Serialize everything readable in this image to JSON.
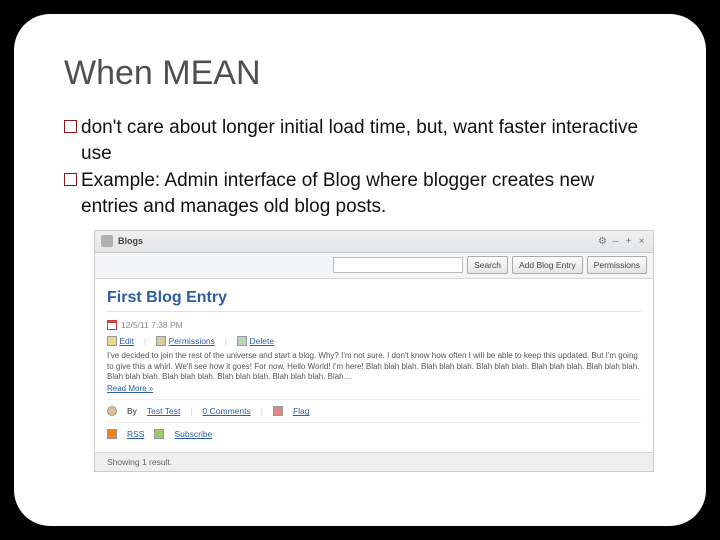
{
  "slide": {
    "title": "When MEAN",
    "bullets": [
      "don't care about longer initial load time, but, want faster interactive use",
      "Example: Admin interface of Blog where blogger creates new entries and manages old blog posts."
    ]
  },
  "shot": {
    "window_title": "Blogs",
    "toolbar": {
      "search_btn": "Search",
      "add_btn": "Add Blog Entry",
      "perm_btn": "Permissions"
    },
    "entry": {
      "title": "First Blog Entry",
      "timestamp": "12/5/11 7:38 PM",
      "actions": {
        "edit": "Edit",
        "permissions": "Permissions",
        "delete": "Delete"
      },
      "body": "I've decided to join the rest of the universe and start a blog. Why? I'm not sure. I don't know how often I will be able to keep this updated. But I'm going to give this a whirl. We'll see how it goes! For now, Hello World! I'm here!  Blah blah blah. Blah blah blah. Blah blah blah. Blah blah blah. Blah blah blah. Blah blah blah. Blah blah blah. Blah blah blah. Blah blah blah. Blah…",
      "readmore": "Read More »",
      "author_prefix": "By",
      "author": "Test Test",
      "comments": "0 Comments",
      "flag": "Flag",
      "rss": "RSS",
      "subscribe": "Subscribe"
    },
    "footer": "Showing 1 result."
  }
}
